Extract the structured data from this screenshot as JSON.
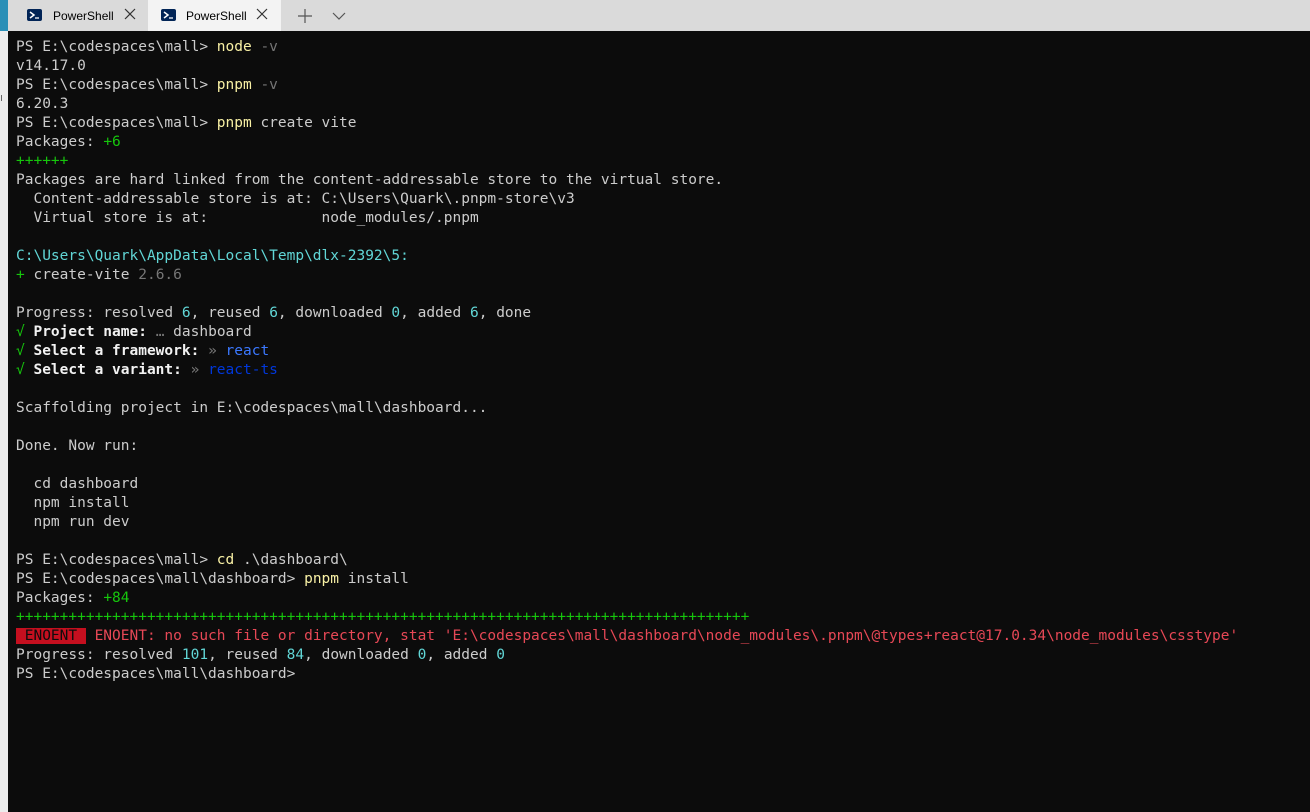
{
  "tabs": [
    {
      "label": "PowerShell",
      "active": false
    },
    {
      "label": "PowerShell",
      "active": true
    }
  ],
  "colors": {
    "command": "#f9f1a5",
    "number": "#61d6d6",
    "success": "#16c60c",
    "error": "#e74856",
    "link_blue": "#3b78ff"
  },
  "terminal": {
    "l1": {
      "prompt": "PS E:\\codespaces\\mall> ",
      "cmd": "node",
      "args": " -v"
    },
    "l2": "v14.17.0",
    "l3": {
      "prompt": "PS E:\\codespaces\\mall> ",
      "cmd": "pnpm",
      "args": " -v"
    },
    "l4": "6.20.3",
    "l5": {
      "prompt": "PS E:\\codespaces\\mall> ",
      "cmd": "pnpm",
      "args": " create vite"
    },
    "l6": {
      "label": "Packages: ",
      "value": "+6"
    },
    "l7": "++++++",
    "l8": "Packages are hard linked from the content-addressable store to the virtual store.",
    "l9": "  Content-addressable store is at: C:\\Users\\Quark\\.pnpm-store\\v3",
    "l10": "  Virtual store is at:             node_modules/.pnpm",
    "l12": "C:\\Users\\Quark\\AppData\\Local\\Temp\\dlx-2392\\5:",
    "l13": {
      "plus": "+ ",
      "name": "create-vite ",
      "version": "2.6.6"
    },
    "l15": {
      "p1": "Progress: resolved ",
      "n1": "6",
      "p2": ", reused ",
      "n2": "6",
      "p3": ", downloaded ",
      "n3": "0",
      "p4": ", added ",
      "n4": "6",
      "p5": ", done"
    },
    "l16": {
      "check": "√ ",
      "label": "Project name:",
      "sep": " … ",
      "value": "dashboard"
    },
    "l17": {
      "check": "√ ",
      "label": "Select a framework:",
      "sep": " » ",
      "value": "react"
    },
    "l18": {
      "check": "√ ",
      "label": "Select a variant:",
      "sep": " » ",
      "value": "react-ts"
    },
    "l20": "Scaffolding project in E:\\codespaces\\mall\\dashboard...",
    "l22": "Done. Now run:",
    "l24": "  cd dashboard",
    "l25": "  npm install",
    "l26": "  npm run dev",
    "l28": {
      "prompt": "PS E:\\codespaces\\mall> ",
      "cmd": "cd",
      "args": " .\\dashboard\\"
    },
    "l29": {
      "prompt": "PS E:\\codespaces\\mall\\dashboard> ",
      "cmd": "pnpm",
      "args": " install"
    },
    "l30": {
      "label": "Packages: ",
      "value": "+84"
    },
    "l31": "++++++++++++++++++++++++++++++++++++++++++++++++++++++++++++++++++++++++++++++++++++",
    "l32": {
      "badge": " ENOENT ",
      "msg": " ENOENT: no such file or directory, stat 'E:\\codespaces\\mall\\dashboard\\node_modules\\.pnpm\\@types+react@17.0.34\\node_modules\\csstype'"
    },
    "l33": {
      "p1": "Progress: resolved ",
      "n1": "101",
      "p2": ", reused ",
      "n2": "84",
      "p3": ", downloaded ",
      "n3": "0",
      "p4": ", added ",
      "n4": "0"
    },
    "l34": "PS E:\\codespaces\\mall\\dashboard> "
  }
}
